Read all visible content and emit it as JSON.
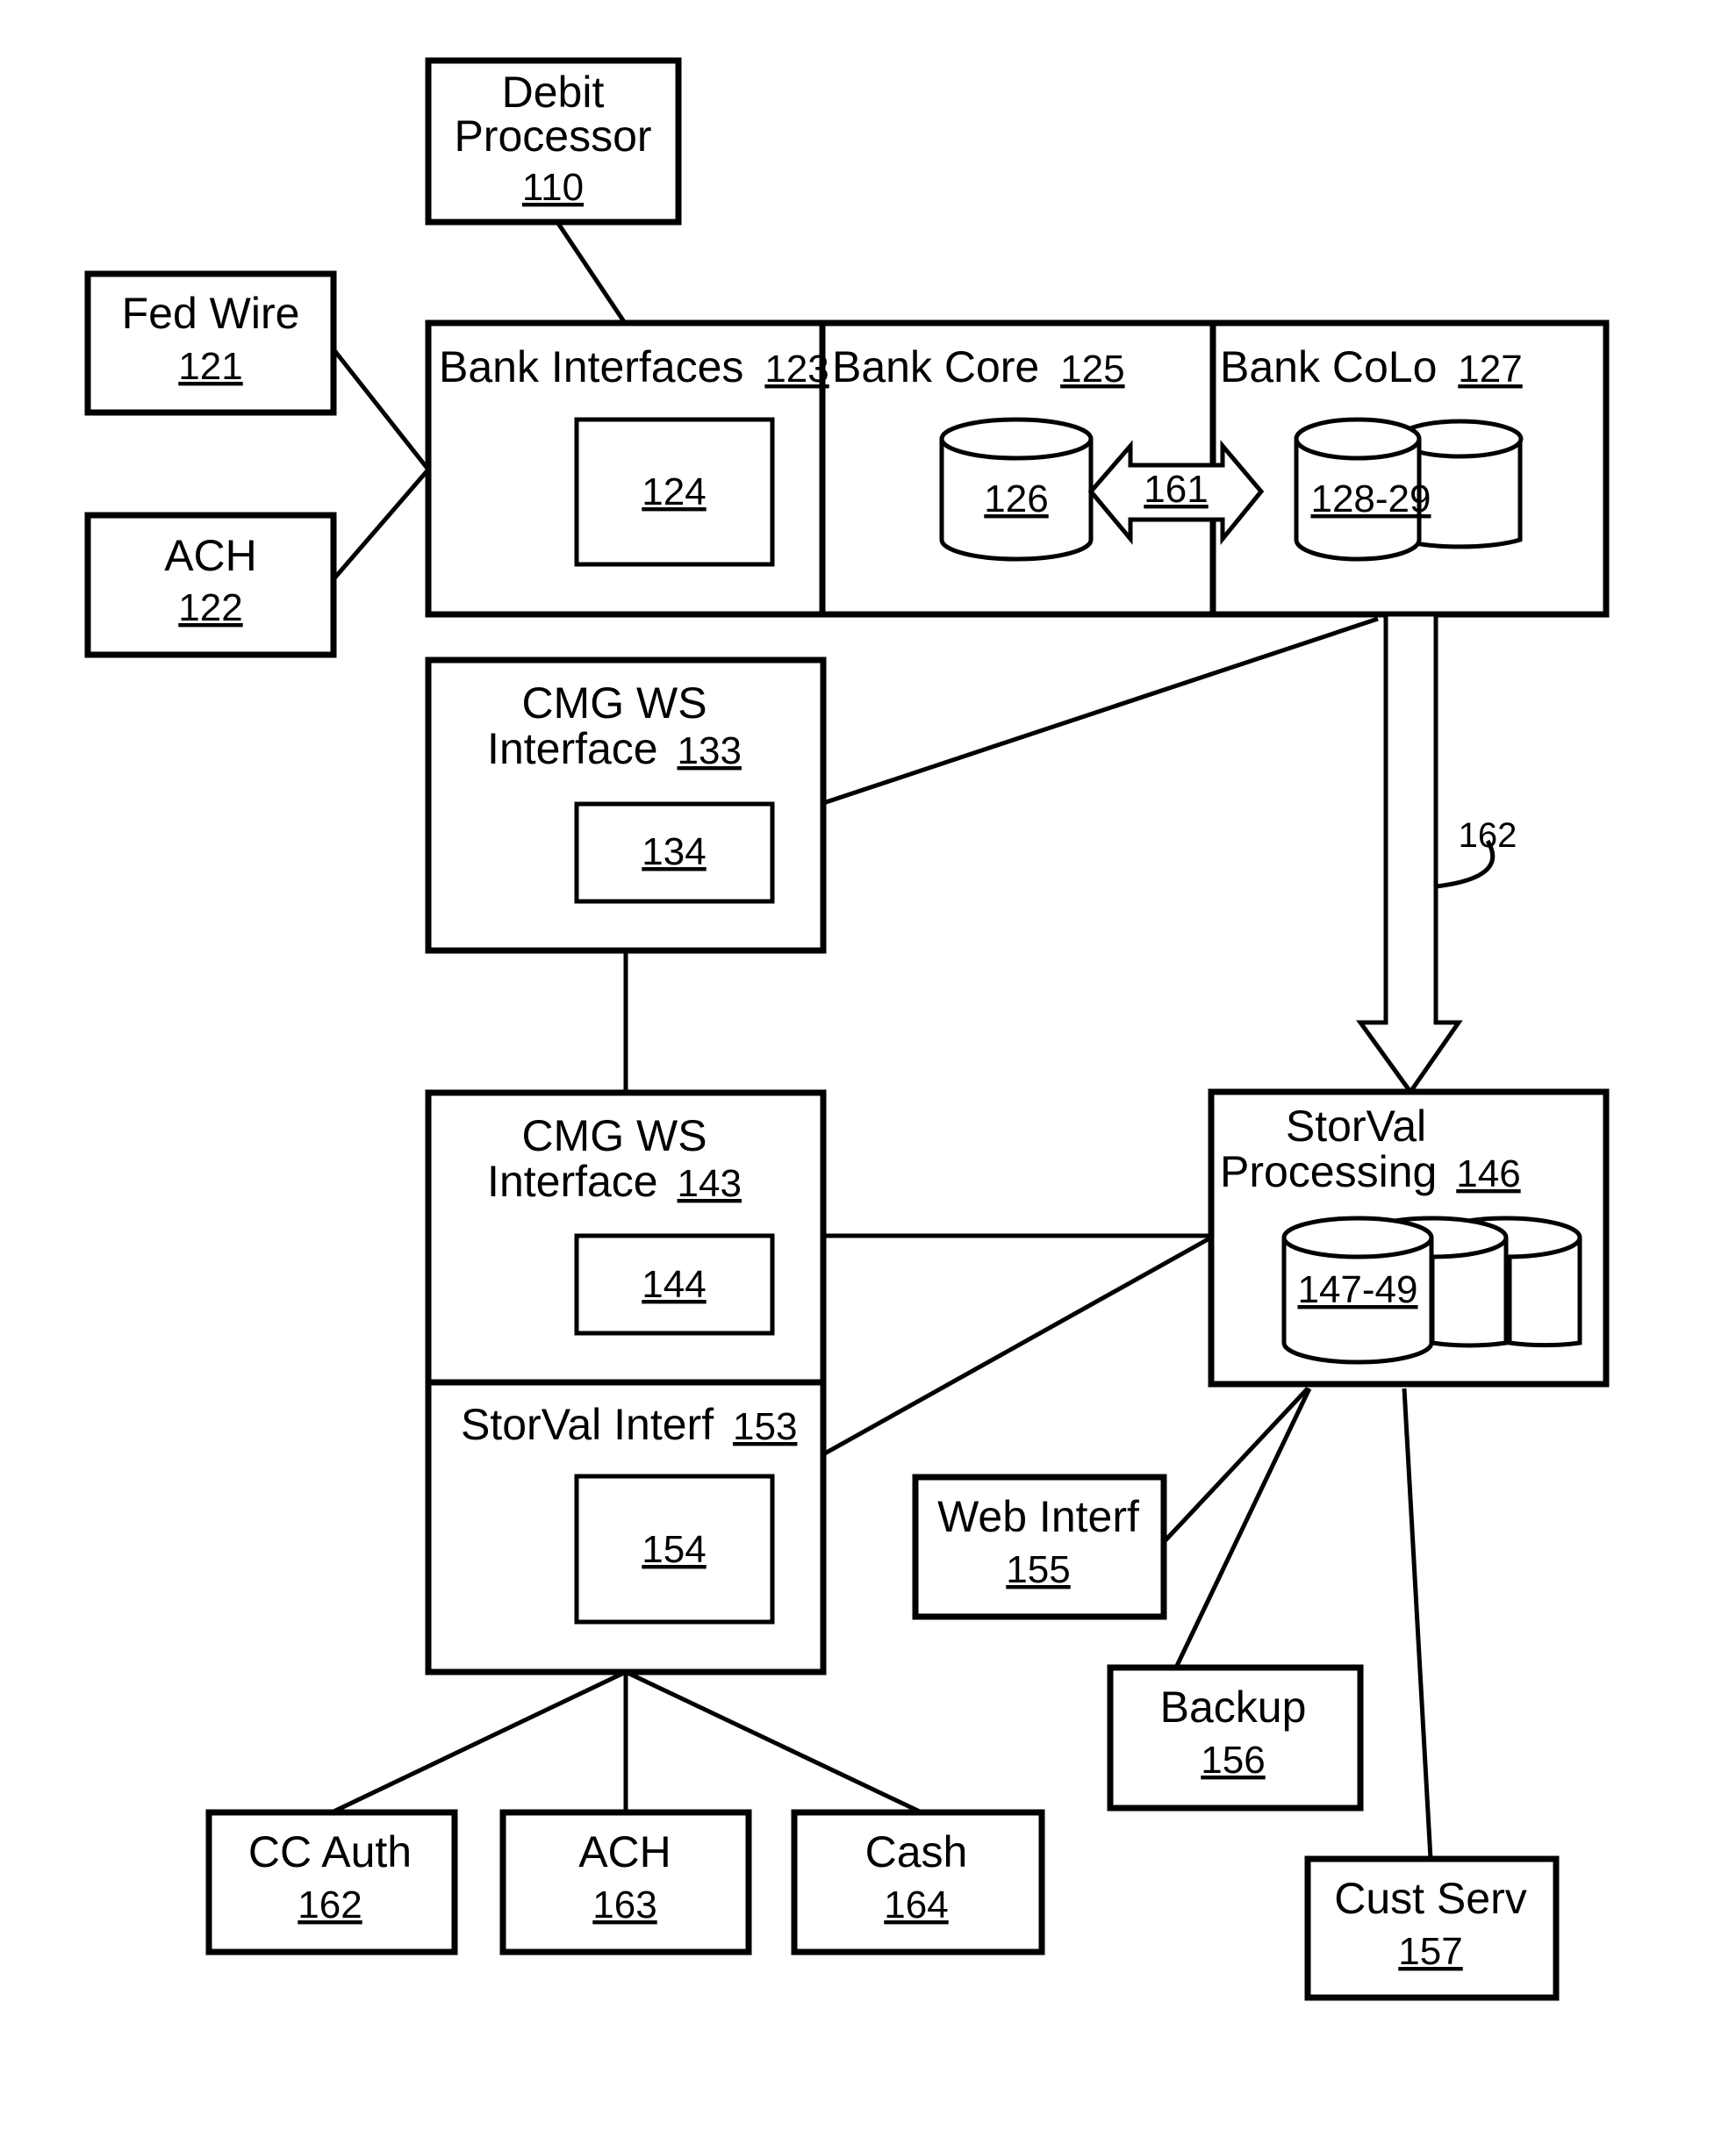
{
  "diagram": {
    "nodes": {
      "debit_processor": {
        "title_line1": "Debit",
        "title_line2": "Processor",
        "ref": "110"
      },
      "fed_wire": {
        "title": "Fed Wire",
        "ref": "121"
      },
      "ach_122": {
        "title": "ACH",
        "ref": "122"
      },
      "bank_interfaces": {
        "title": "Bank Interfaces",
        "ref": "123",
        "inner_ref": "124"
      },
      "bank_core": {
        "title": "Bank Core",
        "ref": "125",
        "db_ref": "126"
      },
      "bank_colo": {
        "title": "Bank CoLo",
        "ref": "127",
        "db_ref": "128-29"
      },
      "cmg_ws_133": {
        "title_line1": "CMG WS",
        "title_line2": "Interface",
        "ref": "133",
        "inner_ref": "134"
      },
      "cmg_ws_143": {
        "title_line1": "CMG WS",
        "title_line2": "Interface",
        "ref": "143",
        "inner_ref": "144"
      },
      "storval_interf": {
        "title": "StorVal Interf",
        "ref": "153",
        "inner_ref": "154"
      },
      "storval_processing": {
        "title_line1": "StorVal",
        "title_line2": "Processing",
        "ref": "146",
        "db_ref": "147-49"
      },
      "web_interf": {
        "title": "Web Interf",
        "ref": "155"
      },
      "backup": {
        "title": "Backup",
        "ref": "156"
      },
      "cust_serv": {
        "title": "Cust Serv",
        "ref": "157"
      },
      "cc_auth": {
        "title": "CC Auth",
        "ref": "162"
      },
      "ach_163": {
        "title": "ACH",
        "ref": "163"
      },
      "cash": {
        "title": "Cash",
        "ref": "164"
      }
    },
    "connectors": {
      "bidirectional_arrow_ref": "161",
      "downward_arrow_ref": "162"
    },
    "edges": [
      {
        "from": "debit_processor",
        "to": "bank_interfaces"
      },
      {
        "from": "fed_wire",
        "to": "bank_interfaces"
      },
      {
        "from": "ach_122",
        "to": "bank_interfaces"
      },
      {
        "from": "bank_core",
        "to": "bank_colo",
        "type": "bidirectional-arrow",
        "label": "161"
      },
      {
        "from": "bank_colo",
        "to": "cmg_ws_133"
      },
      {
        "from": "bank_colo",
        "to": "storval_processing",
        "type": "block-arrow",
        "label": "162"
      },
      {
        "from": "cmg_ws_133",
        "to": "cmg_ws_143"
      },
      {
        "from": "cmg_ws_143",
        "to": "storval_processing"
      },
      {
        "from": "storval_interf",
        "to": "storval_processing"
      },
      {
        "from": "storval_processing",
        "to": "web_interf"
      },
      {
        "from": "storval_processing",
        "to": "backup"
      },
      {
        "from": "storval_processing",
        "to": "cust_serv"
      },
      {
        "from": "storval_interf",
        "to": "cc_auth"
      },
      {
        "from": "storval_interf",
        "to": "ach_163"
      },
      {
        "from": "storval_interf",
        "to": "cash"
      }
    ]
  }
}
